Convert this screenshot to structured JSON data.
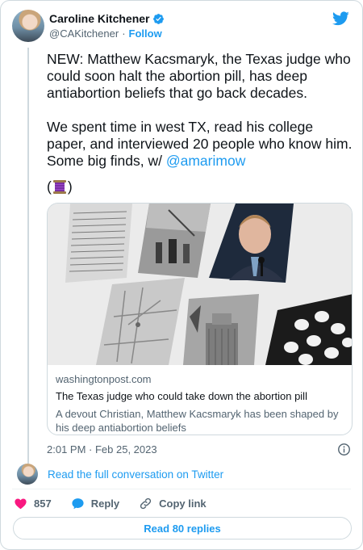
{
  "author": {
    "name": "Caroline Kitchener",
    "handle": "@CAKitchener",
    "separator": "·",
    "follow_label": "Follow"
  },
  "tweet": {
    "paragraph1": "NEW: Matthew Kacsmaryk, the Texas judge who could soon halt the abortion pill, has deep antiabortion beliefs that go back decades.",
    "paragraph2_prefix": "We spent time in west TX, read his college paper, and interviewed 20 people who know him. Some big finds, w/ ",
    "mention": "@amarimow",
    "thread_open": "(",
    "thread_close": ")",
    "thread_emoji": "spool-of-thread"
  },
  "link_card": {
    "domain": "washingtonpost.com",
    "title": "The Texas judge who could take down the abortion pill",
    "description": "A devout Christian, Matthew Kacsmaryk has been shaped by his deep antiabortion beliefs"
  },
  "timestamp": "2:01 PM · Feb 25, 2023",
  "conversation_link": "Read the full conversation on Twitter",
  "actions": {
    "like_count": "857",
    "reply_label": "Reply",
    "copy_label": "Copy link"
  },
  "read_replies_label": "Read 80 replies",
  "colors": {
    "accent": "#1d9bf0",
    "like": "#f91880",
    "text": "#0f1419",
    "muted": "#536471"
  }
}
